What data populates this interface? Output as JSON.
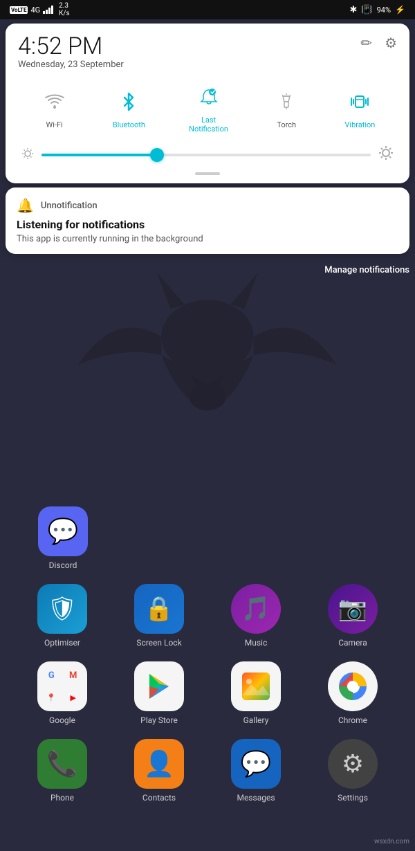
{
  "statusBar": {
    "left": {
      "volte": "VoLTE",
      "signal": "4G",
      "speed": "2.3\nK/s"
    },
    "right": {
      "bluetooth": "BT",
      "vibration": "📳",
      "battery": "94"
    }
  },
  "quickPanel": {
    "time": "4:52 PM",
    "date": "Wednesday, 23 September",
    "editIcon": "✏",
    "settingsIcon": "⚙",
    "toggles": [
      {
        "id": "wifi",
        "label": "Wi-Fi",
        "active": false,
        "icon": "wifi"
      },
      {
        "id": "bluetooth",
        "label": "Bluetooth",
        "active": true,
        "icon": "bluetooth"
      },
      {
        "id": "last-notification",
        "label": "Last\nNotification",
        "active": true,
        "icon": "notification"
      },
      {
        "id": "torch",
        "label": "Torch",
        "active": false,
        "icon": "torch"
      },
      {
        "id": "vibration",
        "label": "Vibration",
        "active": true,
        "icon": "vibration"
      }
    ],
    "brightness": {
      "fillPercent": 35
    }
  },
  "notification": {
    "appName": "Unnotification",
    "title": "Listening for notifications",
    "body": "This app is currently running in the background",
    "manageLabel": "Manage notifications"
  },
  "apps": {
    "rows": [
      [
        {
          "name": "Discord",
          "color": "#5865F2",
          "icon": "💬"
        },
        {
          "name": "",
          "color": "transparent",
          "icon": ""
        },
        {
          "name": "",
          "color": "transparent",
          "icon": ""
        },
        {
          "name": "",
          "color": "transparent",
          "icon": ""
        }
      ],
      [
        {
          "name": "Optimiser",
          "color": "#0d7ab5",
          "icon": "🛡"
        },
        {
          "name": "Screen Lock",
          "color": "#1565C0",
          "icon": "🔒"
        },
        {
          "name": "Music",
          "color": "#7B1FA2",
          "icon": "🎵"
        },
        {
          "name": "Camera",
          "color": "#4a148c",
          "icon": "📷"
        }
      ],
      [
        {
          "name": "Google",
          "color": "#f5f5f5",
          "icon": "G"
        },
        {
          "name": "Play Store",
          "color": "#f5f5f5",
          "icon": "▶"
        },
        {
          "name": "Gallery",
          "color": "#f5f5f5",
          "icon": "🖼"
        },
        {
          "name": "Chrome",
          "color": "#f5f5f5",
          "icon": "🌐"
        }
      ],
      [
        {
          "name": "Phone",
          "color": "#2E7D32",
          "icon": "📞"
        },
        {
          "name": "Contacts",
          "color": "#F57F17",
          "icon": "👤"
        },
        {
          "name": "Messages",
          "color": "#1565C0",
          "icon": "💬"
        },
        {
          "name": "Settings",
          "color": "#424242",
          "icon": "⚙"
        }
      ]
    ]
  },
  "watermark": "wsxdn.com"
}
